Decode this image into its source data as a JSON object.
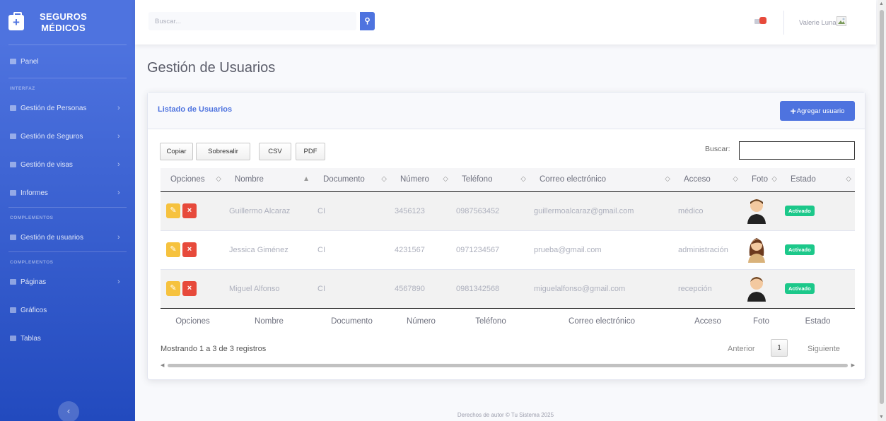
{
  "brand": {
    "line1": "SEGUROS",
    "line2": "MÉDICOS",
    "icon": "medkit-icon"
  },
  "sidebar": {
    "panel": "Panel",
    "heading1": "INTERFAZ",
    "items1": [
      {
        "label": "Gestión de Personas",
        "icon": "users-icon"
      },
      {
        "label": "Gestión de Seguros",
        "icon": "file-icon"
      },
      {
        "label": "Gestión de visas",
        "icon": "card-icon"
      },
      {
        "label": "Informes",
        "icon": "report-icon"
      }
    ],
    "heading2": "COMPLEMENTOS",
    "users_item": "Gestión de usuarios",
    "heading3": "COMPLEMENTOS",
    "items3": [
      {
        "label": "Páginas"
      },
      {
        "label": "Gráficos"
      },
      {
        "label": "Tablas"
      }
    ],
    "toggle": "‹"
  },
  "topbar": {
    "search_placeholder": "Buscar...",
    "user_name": "Valerie Luna"
  },
  "page_title": "Gestión de Usuarios",
  "card": {
    "title": "Listado de Usuarios",
    "add_button": "Agregar usuario",
    "add_plus": "+",
    "export_buttons": [
      "Copiar",
      "Sobresalir",
      "CSV",
      "PDF"
    ],
    "filter_label": "Buscar:",
    "columns": [
      "Opciones",
      "Nombre",
      "Documento",
      "Número",
      "Teléfono",
      "Correo electrónico",
      "Acceso",
      "Foto",
      "Estado"
    ],
    "sort_icons": [
      "◇",
      "▲",
      "◇",
      "◇",
      "◇",
      "◇",
      "◇",
      "◇",
      "◇"
    ],
    "rows": [
      {
        "nombre": "Guillermo Alcaraz",
        "documento": "CI",
        "numero": "3456123",
        "telefono": "0987563452",
        "correo": "guillermoalcaraz@gmail.com",
        "acceso": "médico",
        "foto": "male",
        "estado": "Activado"
      },
      {
        "nombre": "Jessica Giménez",
        "documento": "CI",
        "numero": "4231567",
        "telefono": "0971234567",
        "correo": "prueba@gmail.com",
        "acceso": "administración",
        "foto": "female",
        "estado": "Activado"
      },
      {
        "nombre": "Miguel Alfonso",
        "documento": "CI",
        "numero": "4567890",
        "telefono": "0981342568",
        "correo": "miguelalfonso@gmail.com",
        "acceso": "recepción",
        "foto": "male",
        "estado": "Activado"
      }
    ],
    "info": "Mostrando 1 a 3 de 3 registros",
    "prev": "Anterior",
    "page": "1",
    "next": "Siguiente"
  },
  "footer": "Derechos de autor © Tu Sistema 2025",
  "colors": {
    "primary": "#4e73df",
    "warning": "#f6c23e",
    "danger": "#e74a3b",
    "success": "#1cc88a"
  }
}
